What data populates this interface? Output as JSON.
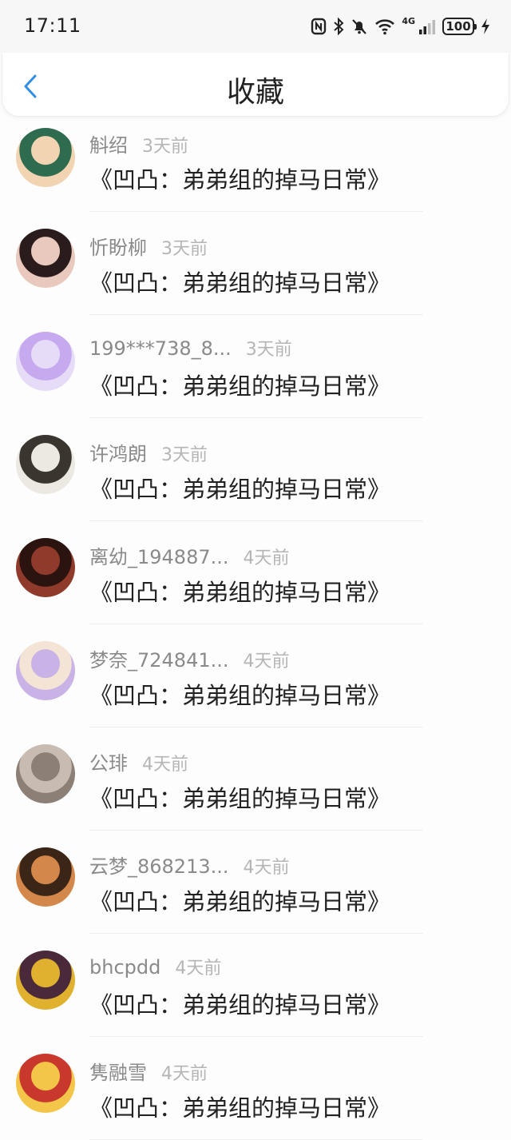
{
  "status_bar": {
    "time": "17:11",
    "network": "4G",
    "battery": "100"
  },
  "header": {
    "title": "收藏"
  },
  "items": [
    {
      "username": "斛绍",
      "time": "3天前",
      "book": "《凹凸：弟弟组的掉马日常》",
      "avatar_colors": [
        "#f2d4b3",
        "#2f6b4f"
      ]
    },
    {
      "username": "忻盼柳",
      "time": "3天前",
      "book": "《凹凸：弟弟组的掉马日常》",
      "avatar_colors": [
        "#e9c9bd",
        "#2a1c1c"
      ]
    },
    {
      "username": "199***738_8...",
      "time": "3天前",
      "book": "《凹凸：弟弟组的掉马日常》",
      "avatar_colors": [
        "#e7dcf8",
        "#c7a9ef"
      ]
    },
    {
      "username": "许鸿朗",
      "time": "3天前",
      "book": "《凹凸：弟弟组的掉马日常》",
      "avatar_colors": [
        "#ece8e2",
        "#3b3530"
      ]
    },
    {
      "username": "离幼_194887...",
      "time": "4天前",
      "book": "《凹凸：弟弟组的掉马日常》",
      "avatar_colors": [
        "#8f3a2a",
        "#2b1310"
      ]
    },
    {
      "username": "梦奈_724841...",
      "time": "4天前",
      "book": "《凹凸：弟弟组的掉马日常》",
      "avatar_colors": [
        "#c9b3e6",
        "#f3e4d6"
      ]
    },
    {
      "username": "公琲",
      "time": "4天前",
      "book": "《凹凸：弟弟组的掉马日常》",
      "avatar_colors": [
        "#8b7f76",
        "#c8bcb2"
      ]
    },
    {
      "username": "云梦_868213...",
      "time": "4天前",
      "book": "《凹凸：弟弟组的掉马日常》",
      "avatar_colors": [
        "#d3874a",
        "#3a2516"
      ]
    },
    {
      "username": "bhcpdd",
      "time": "4天前",
      "book": "《凹凸：弟弟组的掉马日常》",
      "avatar_colors": [
        "#e0b12e",
        "#4a2a3a"
      ]
    },
    {
      "username": "隽融雪",
      "time": "4天前",
      "book": "《凹凸：弟弟组的掉马日常》",
      "avatar_colors": [
        "#f3c64a",
        "#c9382c"
      ]
    }
  ]
}
